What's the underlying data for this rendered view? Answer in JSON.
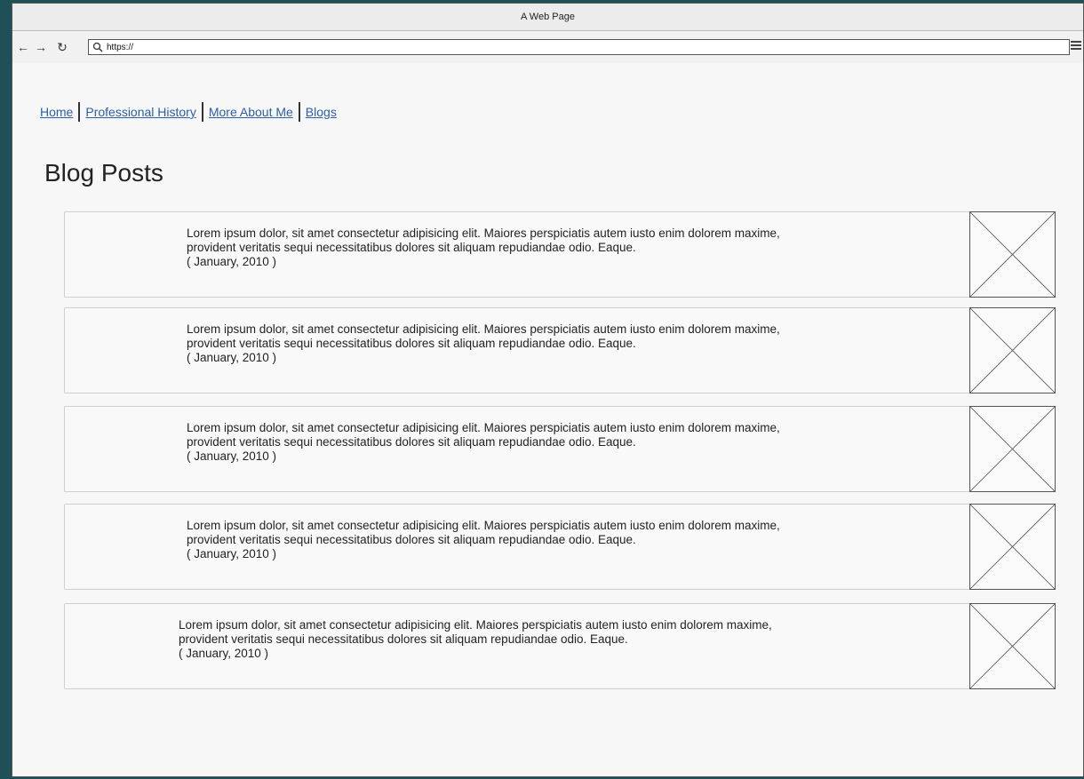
{
  "window": {
    "title": "A Web Page"
  },
  "toolbar": {
    "back_icon": "arrow-left-icon",
    "forward_icon": "arrow-right-icon",
    "reload_icon": "reload-icon",
    "url": "https://",
    "menu_icon": "hamburger-menu-icon"
  },
  "nav": {
    "items": [
      {
        "label": "Home"
      },
      {
        "label": "Professional History"
      },
      {
        "label": "More About Me"
      },
      {
        "label": "Blogs"
      }
    ]
  },
  "page": {
    "title": "Blog Posts"
  },
  "posts": [
    {
      "line1": "Lorem ipsum dolor, sit amet consectetur adipisicing elit. Maiores perspiciatis autem iusto enim dolorem maxime,",
      "line2": "provident veritatis sequi necessitatibus dolores sit aliquam repudiandae odio. Eaque.",
      "date": "( January, 2010 )"
    },
    {
      "line1": "Lorem ipsum dolor, sit amet consectetur adipisicing elit. Maiores perspiciatis autem iusto enim dolorem maxime,",
      "line2": "provident veritatis sequi necessitatibus dolores sit aliquam repudiandae odio. Eaque.",
      "date": "( January, 2010 )"
    },
    {
      "line1": "Lorem ipsum dolor, sit amet consectetur adipisicing elit. Maiores perspiciatis autem iusto enim dolorem maxime,",
      "line2": "provident veritatis sequi necessitatibus dolores sit aliquam repudiandae odio. Eaque.",
      "date": "( January, 2010 )"
    },
    {
      "line1": "Lorem ipsum dolor, sit amet consectetur adipisicing elit. Maiores perspiciatis autem iusto enim dolorem maxime,",
      "line2": "provident veritatis sequi necessitatibus dolores sit aliquam repudiandae odio. Eaque.",
      "date": "( January, 2010 )"
    },
    {
      "line1": "Lorem ipsum dolor, sit amet consectetur adipisicing elit. Maiores perspiciatis autem iusto enim dolorem maxime,",
      "line2": "provident veritatis sequi necessitatibus dolores sit aliquam repudiandae odio. Eaque.",
      "date": "( January, 2010 )"
    }
  ],
  "colors": {
    "desktop": "#1f4f57",
    "link": "#2c5fa8"
  }
}
